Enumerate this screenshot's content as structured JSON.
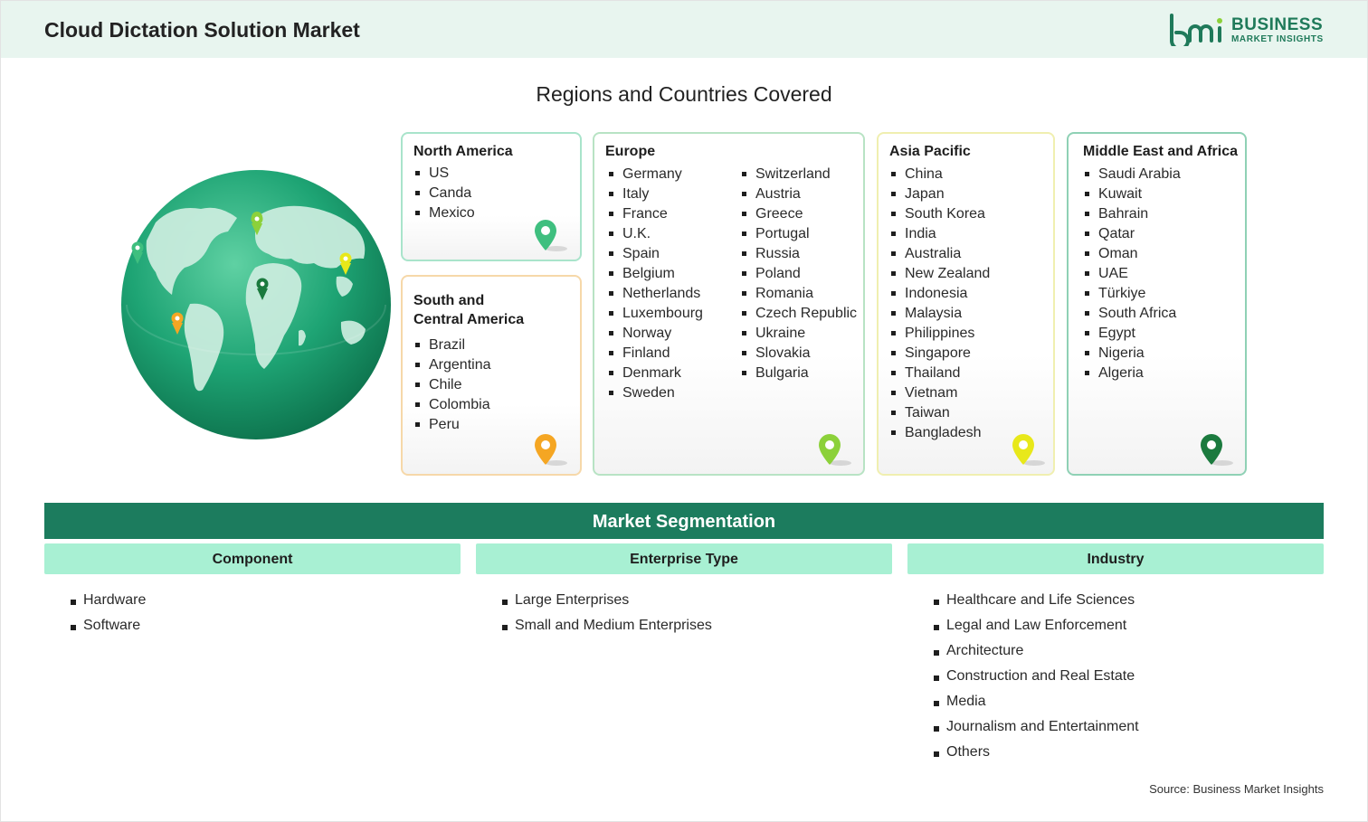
{
  "header": {
    "title": "Cloud Dictation Solution Market",
    "logo_line1": "BUSINESS",
    "logo_line2": "MARKET INSIGHTS",
    "logo_mark": "bmi"
  },
  "regions": {
    "title": "Regions and Countries Covered",
    "north_america": {
      "title": "North America",
      "countries": [
        "US",
        "Canda",
        "Mexico"
      ],
      "pin_color": "#3fbf7f"
    },
    "south_central_america": {
      "title_line1": "South and",
      "title_line2": "Central America",
      "countries": [
        "Brazil",
        "Argentina",
        "Chile",
        "Colombia",
        "Peru"
      ],
      "pin_color": "#f5a623"
    },
    "europe": {
      "title": "Europe",
      "countries_col1": [
        "Germany",
        "Italy",
        "France",
        "U.K.",
        "Spain",
        "Belgium",
        "Netherlands",
        "Luxembourg",
        "Norway",
        "Finland",
        "Denmark",
        "Sweden"
      ],
      "countries_col2": [
        "Switzerland",
        "Austria",
        "Greece",
        "Portugal",
        "Russia",
        "Poland",
        "Romania",
        "Czech Republic",
        "Ukraine",
        "Slovakia",
        "Bulgaria"
      ],
      "pin_color": "#8cd13a"
    },
    "asia_pacific": {
      "title": "Asia Pacific",
      "countries": [
        "China",
        "Japan",
        "South Korea",
        "India",
        "Australia",
        "New Zealand",
        "Indonesia",
        "Malaysia",
        "Philippines",
        "Singapore",
        "Thailand",
        "Vietnam",
        "Taiwan",
        "Bangladesh"
      ],
      "pin_color": "#e8e81a"
    },
    "middle_east_africa": {
      "title": "Middle East and Africa",
      "countries": [
        "Saudi Arabia",
        "Kuwait",
        "Bahrain",
        "Qatar",
        "Oman",
        "UAE",
        "Türkiye",
        "South Africa",
        "Egypt",
        "Nigeria",
        "Algeria"
      ],
      "pin_color": "#1b7a3e"
    }
  },
  "segmentation": {
    "title": "Market Segmentation",
    "component": {
      "title": "Component",
      "items": [
        "Hardware",
        "Software"
      ]
    },
    "enterprise_type": {
      "title": "Enterprise Type",
      "items": [
        "Large Enterprises",
        "Small and Medium Enterprises"
      ]
    },
    "industry": {
      "title": "Industry",
      "items": [
        "Healthcare and Life Sciences",
        "Legal and Law Enforcement",
        "Architecture",
        "Construction and Real Estate",
        "Media",
        "Journalism and Entertainment",
        "Others"
      ]
    }
  },
  "source": "Source: Business Market Insights",
  "colors": {
    "brand": "#1c7c5e",
    "header_bg": "#e8f5ef",
    "segment_head": "#a8f0d3"
  }
}
